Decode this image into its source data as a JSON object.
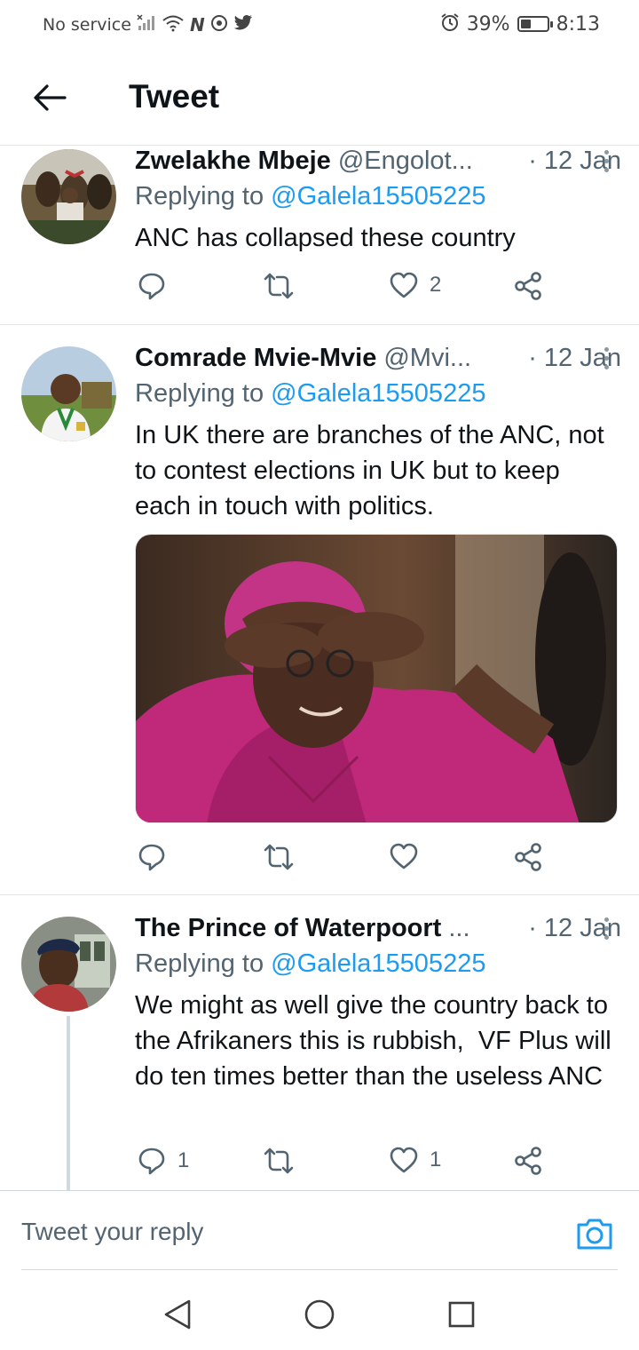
{
  "status_bar": {
    "carrier": "No service",
    "battery_percent": "39%",
    "battery_level": 0.39,
    "time": "8:13",
    "icons": [
      "signal-off-icon",
      "wifi-icon",
      "nfc-icon",
      "vpn-icon",
      "twitter-bird-icon",
      "alarm-icon",
      "battery-icon"
    ]
  },
  "header": {
    "title": "Tweet",
    "back_icon": "arrow-left-icon"
  },
  "tweets": [
    {
      "name": "Zwelakhe Mbeje",
      "handle": "@Engolot...",
      "time": "· 12 Jan",
      "replying_prefix": "Replying to ",
      "replying_to": "@Galela15505225",
      "text": "ANC has collapsed these country",
      "reply_count": "",
      "retweet_count": "",
      "like_count": "2"
    },
    {
      "name": "Comrade Mvie-Mvie",
      "handle": "@Mvi...",
      "time": "· 12 Jan",
      "replying_prefix": "Replying to ",
      "replying_to": "@Galela15505225",
      "text": "In UK there are branches of the ANC, not to contest elections in UK but to keep each in touch with politics.",
      "reply_count": "",
      "retweet_count": "",
      "like_count": ""
    },
    {
      "name": "The Prince of Waterpoort",
      "handle": "...",
      "time": "· 12 Jan",
      "replying_prefix": "Replying to ",
      "replying_to": "@Galela15505225",
      "text": "We might as well give the country back to the Afrikaners this is rubbish,  VF Plus will do ten times better than the useless ANC",
      "reply_count": "1",
      "retweet_count": "",
      "like_count": "1"
    }
  ],
  "composer": {
    "placeholder": "Tweet your reply",
    "camera_icon": "camera-icon"
  },
  "colors": {
    "accent": "#1d9bf0",
    "text_primary": "#0f1419",
    "text_secondary": "#536471",
    "divider": "#e1e4e8"
  }
}
